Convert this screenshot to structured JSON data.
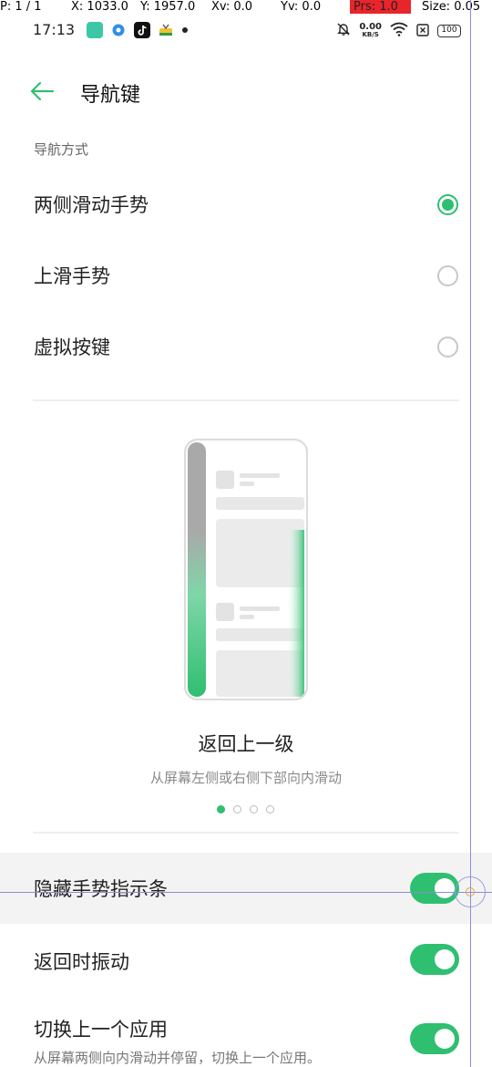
{
  "debug": {
    "p": "P: 1 / 1",
    "x": "X: 1033.0",
    "y": "Y: 1957.0",
    "xv": "Xv: 0.0",
    "yv": "Yv: 0.0",
    "prs": "Prs: 1.0",
    "size": "Size: 0.05"
  },
  "status_bar": {
    "time": "17:13",
    "net_speed": "0.00",
    "net_unit": "KB/S",
    "battery": "100"
  },
  "header": {
    "title": "导航键"
  },
  "nav_section": {
    "label": "导航方式",
    "options": [
      {
        "label": "两侧滑动手势",
        "selected": true
      },
      {
        "label": "上滑手势",
        "selected": false
      },
      {
        "label": "虚拟按键",
        "selected": false
      }
    ]
  },
  "illustration": {
    "title": "返回上一级",
    "subtitle": "从屏幕左侧或右侧下部向内滑动",
    "page_count": 4,
    "active_page": 1
  },
  "toggles": [
    {
      "label": "隐藏手势指示条",
      "on": true
    },
    {
      "label": "返回时振动",
      "on": true
    },
    {
      "label": "切换上一个应用",
      "desc": "从屏幕两侧向内滑动并停留，切换上一个应用。",
      "on": true
    }
  ],
  "colors": {
    "accent": "#2fbf71"
  }
}
